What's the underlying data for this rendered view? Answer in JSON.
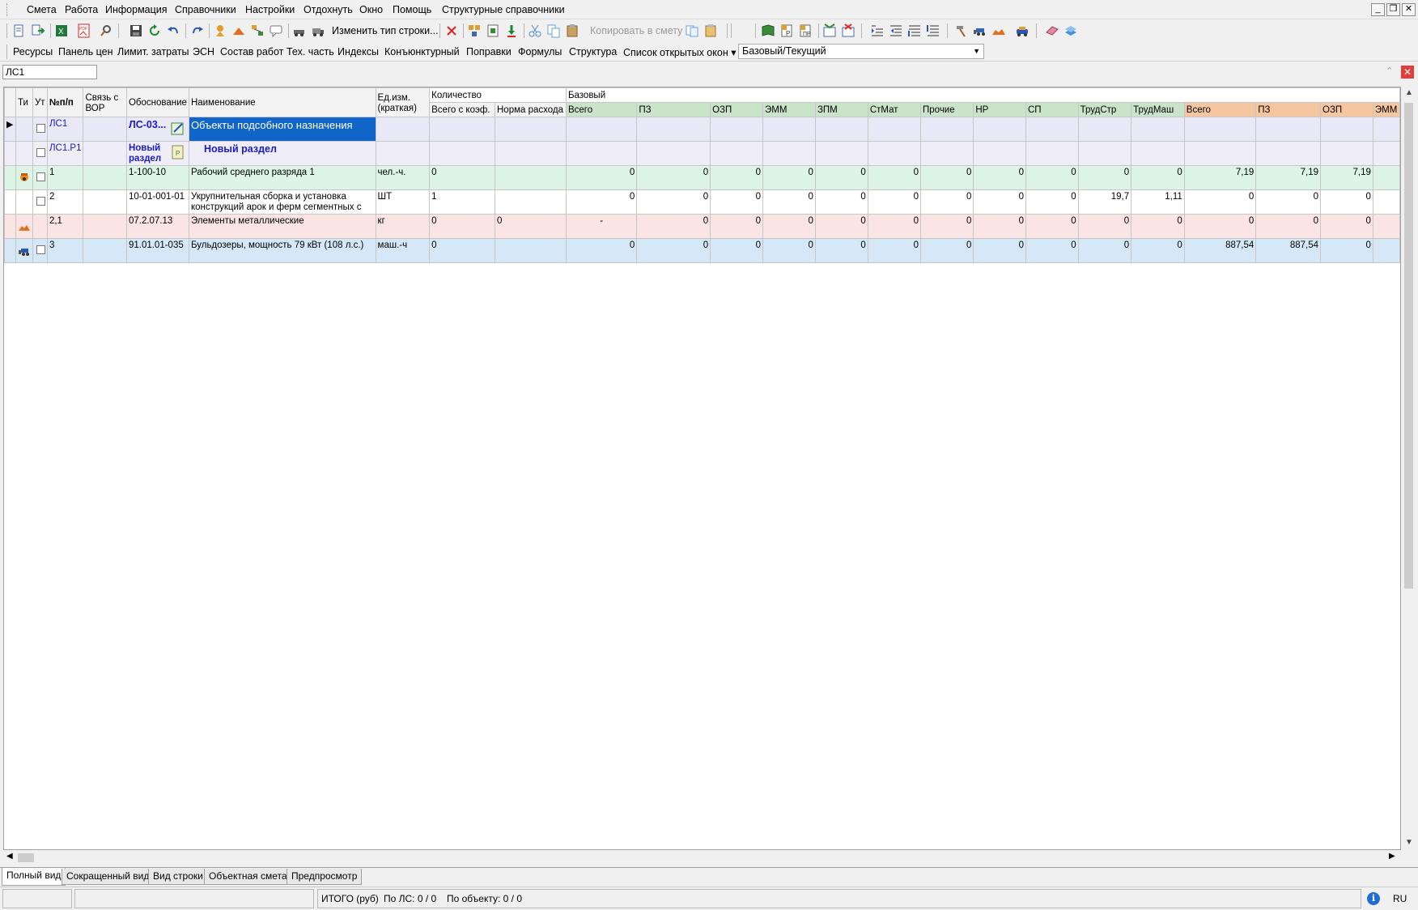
{
  "menu": [
    "Смета",
    "Работа",
    "Информация",
    "Справочники",
    "Настройки",
    "Отдохнуть",
    "Окно",
    "Помощь",
    "Структурные справочники"
  ],
  "window_controls": {
    "minimize": "_",
    "restore": "❐",
    "close": "✕"
  },
  "toolbar": {
    "change_row_type": "Изменить тип строки...",
    "copy_to_estimate": "Копировать в смету",
    "icons": [
      "new-estimate-icon",
      "import-icon",
      "excel-icon",
      "pdf-icon",
      "find-icon",
      "save-icon",
      "refresh-icon",
      "undo-icon",
      "redo-icon",
      "worker-icon",
      "material-icon",
      "structure-icon",
      "comment-icon",
      "machine-icon",
      "truck-icon",
      "delete-icon",
      "insert-icon",
      "paste-special-icon",
      "move-down-icon",
      "cut-icon",
      "copy-icon",
      "paste-icon",
      "copy-doc-icon",
      "paste-doc-icon",
      "book-icon",
      "price-p-icon",
      "price-pr-icon",
      "filter-icon",
      "filter-off-icon",
      "indent-icon",
      "outdent-icon",
      "list-icon",
      "list-down-icon",
      "hammer-icon",
      "bulldozer-icon",
      "materials-icon",
      "car-icon",
      "eraser-icon",
      "layers-icon"
    ]
  },
  "links": [
    "Ресурсы",
    "Панель цен",
    "Лимит. затраты",
    "ЭСН",
    "Состав работ",
    "Тех. часть",
    "Индексы",
    "Конъюнктурный",
    "Поправки",
    "Формулы",
    "Структура",
    "Список открытых окон ▾"
  ],
  "price_mode": "Базовый/Текущий",
  "address": "ЛС1",
  "grid": {
    "headers": {
      "type": "Ти",
      "ut": "Ут",
      "num": "№п/п",
      "vor": "Связь с ВОР",
      "basis": "Обоснование",
      "name": "Наименование",
      "unit": "Ед.изм. (краткая)",
      "qty_group": "Количество",
      "qty_total": "Всего с коэф.",
      "qty_norm": "Норма расхода",
      "base_group": "Базовый",
      "base_cols": [
        "Всего",
        "ПЗ",
        "ОЗП",
        "ЭММ",
        "ЗПМ",
        "СтМат",
        "Прочие",
        "НР",
        "СП",
        "ТрудСтр",
        "ТрудМаш"
      ],
      "cur_cols": [
        "Всего",
        "ПЗ",
        "ОЗП",
        "ЭММ"
      ]
    },
    "rows": [
      {
        "kind": "ls",
        "num": "ЛС1",
        "basis": "ЛС-03...",
        "name": "Объекты подсобного назначения",
        "unit": "",
        "qty_total": "",
        "qty_norm": "",
        "base": [
          "",
          "",
          "",
          "",
          "",
          "",
          "",
          "",
          "",
          "",
          ""
        ],
        "cur": [
          "",
          "",
          "",
          ""
        ]
      },
      {
        "kind": "razdel",
        "num": "ЛС1.Р1",
        "basis": "Новый раздел",
        "name": "Новый раздел",
        "unit": "",
        "qty_total": "",
        "qty_norm": "",
        "base": [
          "",
          "",
          "",
          "",
          "",
          "",
          "",
          "",
          "",
          "",
          ""
        ],
        "cur": [
          "",
          "",
          "",
          ""
        ]
      },
      {
        "kind": "worker",
        "num": "1",
        "basis": "1-100-10",
        "name": "Рабочий среднего разряда 1",
        "unit": "чел.-ч.",
        "qty_total": "0",
        "qty_norm": "",
        "base": [
          "0",
          "0",
          "0",
          "0",
          "0",
          "0",
          "0",
          "0",
          "0",
          "0",
          "0"
        ],
        "cur": [
          "7,19",
          "7,19",
          "7,19",
          ""
        ]
      },
      {
        "kind": "work",
        "num": "2",
        "basis": "10-01-001-01",
        "name": "Укрупнительная сборка и установка конструкций арок и ферм сегментных с",
        "unit": "ШТ",
        "qty_total": "1",
        "qty_norm": "",
        "base": [
          "0",
          "0",
          "0",
          "0",
          "0",
          "0",
          "0",
          "0",
          "0",
          "19,7",
          "1,11"
        ],
        "cur": [
          "0",
          "0",
          "0",
          ""
        ]
      },
      {
        "kind": "material",
        "num": "2,1",
        "basis": "07.2.07.13",
        "name": "Элементы металлические",
        "unit": "кг",
        "qty_total": "0",
        "qty_norm": "0",
        "base": [
          "-",
          "0",
          "0",
          "0",
          "0",
          "0",
          "0",
          "0",
          "0",
          "0",
          "0"
        ],
        "cur": [
          "0",
          "0",
          "0",
          ""
        ]
      },
      {
        "kind": "machine",
        "num": "3",
        "basis": "91.01.01-035",
        "name": "Бульдозеры, мощность 79 кВт (108 л.с.)",
        "unit": "маш.-ч",
        "qty_total": "0",
        "qty_norm": "",
        "base": [
          "0",
          "0",
          "0",
          "0",
          "0",
          "0",
          "0",
          "0",
          "0",
          "0",
          "0"
        ],
        "cur": [
          "887,54",
          "887,54",
          "0",
          ""
        ]
      }
    ]
  },
  "tabs": [
    "Полный вид",
    "Сокращенный вид",
    "Вид строки",
    "Объектная смета",
    "Предпросмотр"
  ],
  "status": {
    "total": "ИТОГО (руб)",
    "by_ls": "По ЛС: 0 / 0",
    "by_object": "По объекту: 0 / 0",
    "lang": "RU"
  },
  "colors": {
    "base_header": "#c9e4c9",
    "current_header": "#f6c6a0",
    "selection": "#1164c8"
  }
}
